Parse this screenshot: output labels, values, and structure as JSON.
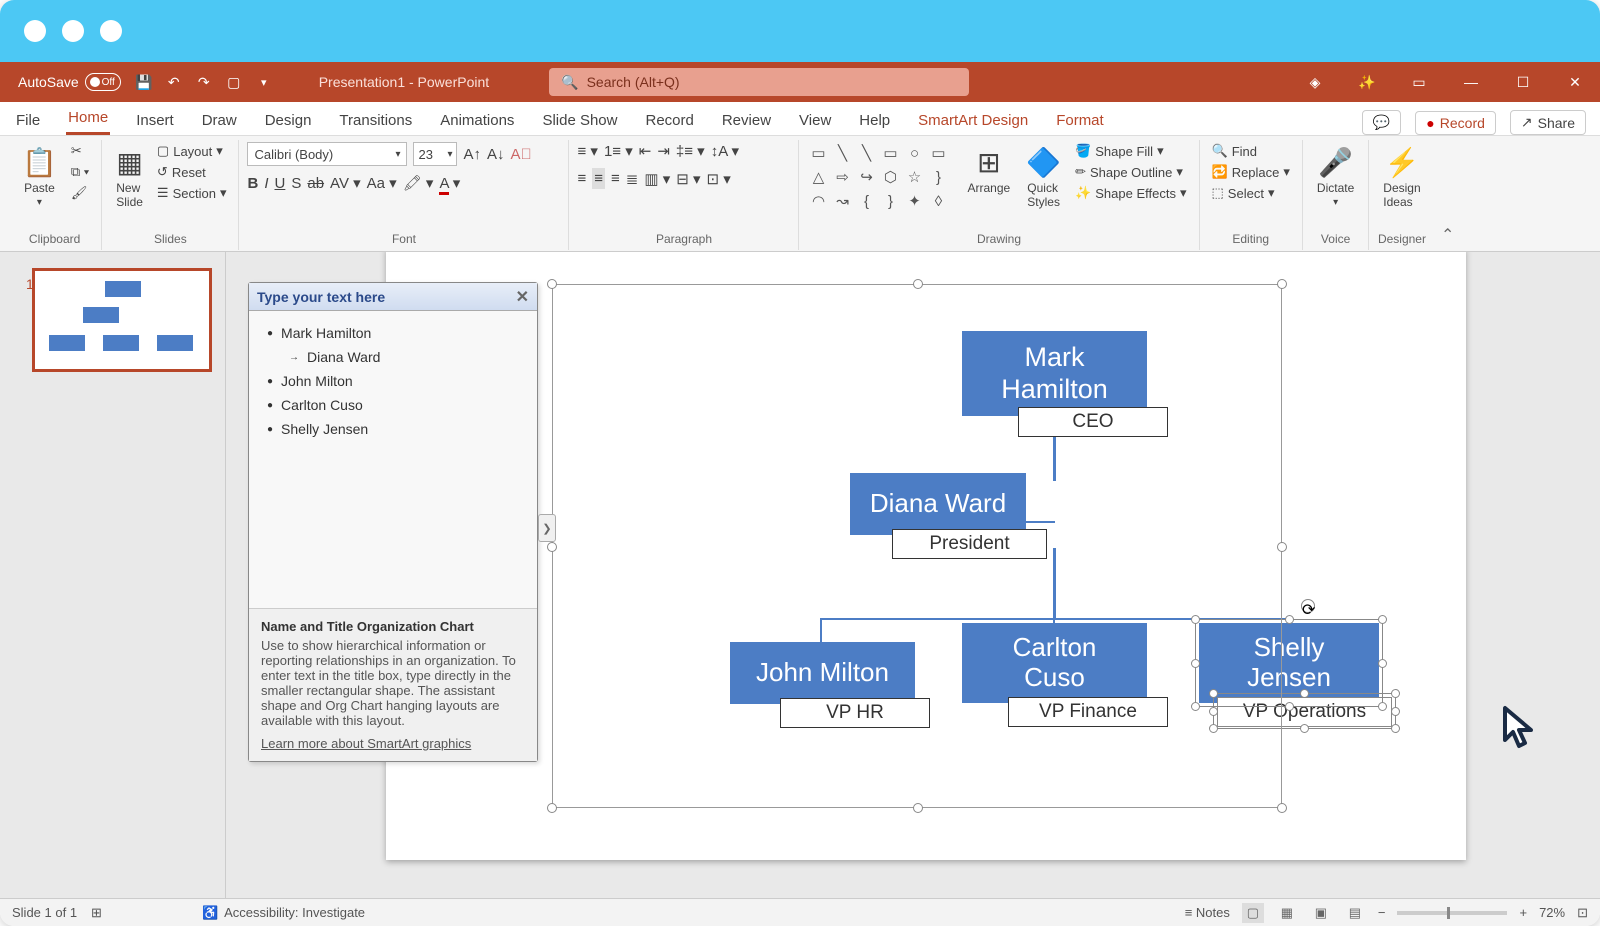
{
  "titlebar": {
    "autosave_label": "AutoSave",
    "autosave_state": "Off",
    "title": "Presentation1 - PowerPoint",
    "search_placeholder": "Search (Alt+Q)"
  },
  "tabs": {
    "file": "File",
    "home": "Home",
    "insert": "Insert",
    "draw": "Draw",
    "design": "Design",
    "transitions": "Transitions",
    "animations": "Animations",
    "slideshow": "Slide Show",
    "record": "Record",
    "review": "Review",
    "view": "View",
    "help": "Help",
    "smartart": "SmartArt Design",
    "format": "Format",
    "record_btn": "Record",
    "share_btn": "Share"
  },
  "ribbon": {
    "clipboard": {
      "paste": "Paste",
      "group": "Clipboard"
    },
    "slides": {
      "newslide": "New\nSlide",
      "layout": "Layout",
      "reset": "Reset",
      "section": "Section",
      "group": "Slides"
    },
    "font": {
      "name": "Calibri (Body)",
      "size": "23",
      "group": "Font"
    },
    "paragraph": {
      "group": "Paragraph"
    },
    "drawing": {
      "arrange": "Arrange",
      "quick": "Quick\nStyles",
      "fill": "Shape Fill",
      "outline": "Shape Outline",
      "effects": "Shape Effects",
      "group": "Drawing"
    },
    "editing": {
      "find": "Find",
      "replace": "Replace",
      "select": "Select",
      "group": "Editing"
    },
    "voice": {
      "dictate": "Dictate",
      "group": "Voice"
    },
    "designer": {
      "ideas": "Design\nIdeas",
      "group": "Designer"
    }
  },
  "panel": {
    "slide_number": "1"
  },
  "textpane": {
    "header": "Type your text here",
    "items": [
      "Mark Hamilton",
      "Diana Ward",
      "John Milton",
      "Carlton Cuso",
      "Shelly Jensen"
    ],
    "desc_title": "Name and Title Organization Chart",
    "desc_body": "Use to show hierarchical information or reporting relationships in an organization. To enter text in the title box, type directly in the smaller rectangular shape. The assistant shape and Org Chart hanging layouts are available with this layout.",
    "link": "Learn more about SmartArt graphics"
  },
  "org": {
    "ceo_name": "Mark Hamilton",
    "ceo_title": "CEO",
    "pres_name": "Diana Ward",
    "pres_title": "President",
    "n1_name": "John Milton",
    "n1_title": "VP HR",
    "n2_name": "Carlton Cuso",
    "n2_title": "VP Finance",
    "n3_name": "Shelly Jensen",
    "n3_title": "VP Operations"
  },
  "status": {
    "slide": "Slide 1 of 1",
    "acc": "Accessibility: Investigate",
    "notes": "Notes",
    "zoom": "72%"
  }
}
